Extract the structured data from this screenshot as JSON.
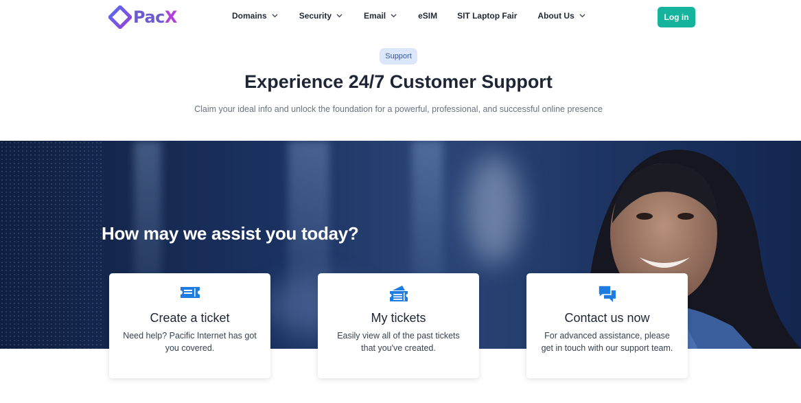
{
  "brand": {
    "name_part1": "Pac",
    "name_part2": "X"
  },
  "nav": {
    "items": [
      {
        "label": "Domains",
        "dropdown": true
      },
      {
        "label": "Security",
        "dropdown": true
      },
      {
        "label": "Email",
        "dropdown": true
      },
      {
        "label": "eSIM",
        "dropdown": false
      },
      {
        "label": "SIT Laptop Fair",
        "dropdown": false
      },
      {
        "label": "About Us",
        "dropdown": true
      }
    ],
    "login_label": "Log in"
  },
  "hero": {
    "badge": "Support",
    "title": "Experience 24/7 Customer Support",
    "subtitle": "Claim your ideal info and unlock the foundation for a powerful, professional, and successful online presence"
  },
  "banner": {
    "heading": "How may we assist you today?"
  },
  "cards": [
    {
      "title": "Create a ticket",
      "description": "Need help? Pacific Internet has got you covered.",
      "icon": "ticket-icon"
    },
    {
      "title": "My tickets",
      "description": "Easily view all of the past tickets that you've created.",
      "icon": "tickets-stack-icon"
    },
    {
      "title": "Contact us now",
      "description": "For advanced assistance, please get in touch with our support team.",
      "icon": "chat-bubbles-icon"
    }
  ],
  "colors": {
    "accent": "#17b49d",
    "icon_blue": "#1e7be0",
    "badge_bg": "#dde7fb",
    "brand_purple": "#6d5bd0",
    "brand_magenta": "#b13fd9"
  }
}
